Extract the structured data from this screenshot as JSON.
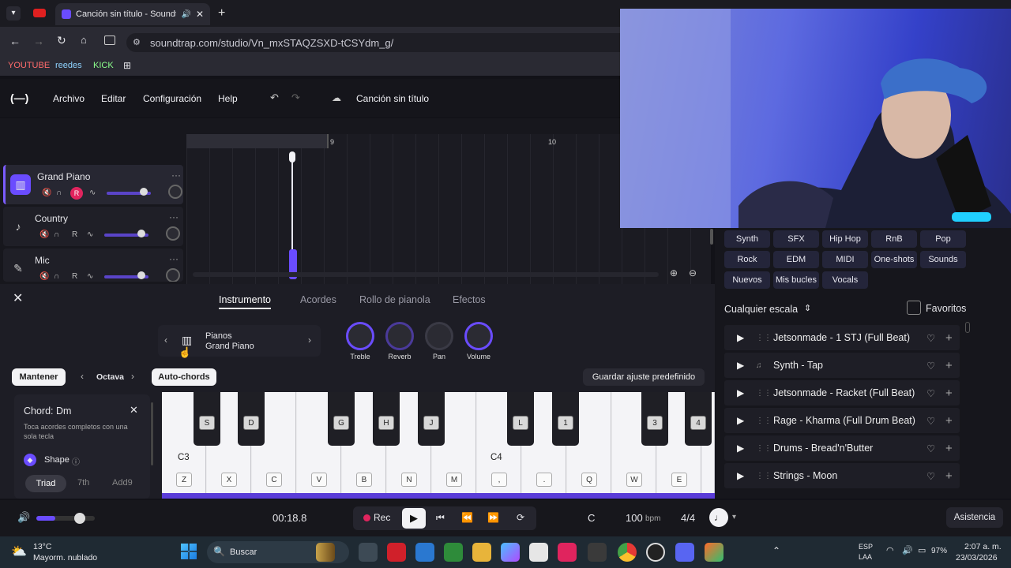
{
  "browser": {
    "tab_title": "Canción sin título - Soundtr",
    "url": "soundtrap.com/studio/Vn_mxSTAQZSXD-tCSYdm_g/",
    "bookmarks": [
      "YOUTUBE",
      "reedes",
      "KICK"
    ]
  },
  "app": {
    "logo": "(—)",
    "menu": [
      "Archivo",
      "Editar",
      "Configuración",
      "Help"
    ],
    "song_title": "Canción sin título"
  },
  "ruler": {
    "marks": [
      "9",
      "10"
    ]
  },
  "tracks": [
    {
      "name": "Grand Piano",
      "icon": "piano-icon",
      "rec": "R"
    },
    {
      "name": "Country",
      "icon": "guitar-icon",
      "rec": "R"
    },
    {
      "name": "Mic",
      "icon": "mic-icon",
      "rec": "R"
    }
  ],
  "instrument_panel": {
    "tabs": [
      "Instrumento",
      "Acordes",
      "Rollo de pianola",
      "Efectos"
    ],
    "active_tab": "Instrumento",
    "category": "Pianos",
    "preset": "Grand Piano",
    "knobs": [
      "Treble",
      "Reverb",
      "Pan",
      "Volume"
    ],
    "hold_label": "Mantener",
    "octave_label": "Octava",
    "autochords_label": "Auto-chords",
    "save_preset": "Guardar ajuste predefinido",
    "chord_title": "Chord: Dm",
    "chord_desc": "Toca acordes completos con una sola tecla",
    "shape_label": "Shape",
    "shape_options": [
      "Triad",
      "7th",
      "Add9"
    ],
    "selected_shape": "Triad"
  },
  "keyboard": {
    "octave_labels": [
      "C3",
      "C4"
    ],
    "white_keys": [
      "Z",
      "X",
      "C",
      "V",
      "B",
      "N",
      "M",
      ",",
      ".",
      "Q",
      "W",
      "E"
    ],
    "black_keys": [
      "S",
      "D",
      "G",
      "H",
      "J",
      "L",
      "1",
      "3",
      "4"
    ]
  },
  "browser_panel": {
    "genres": [
      "Synth",
      "SFX",
      "Hip Hop",
      "RnB",
      "Pop",
      "Rock",
      "EDM",
      "MIDI",
      "One-shots",
      "Sounds",
      "Nuevos",
      "Mis bucles",
      "Vocals"
    ],
    "scale_label": "Cualquier escala",
    "favorites_label": "Favoritos",
    "loops": [
      "Jetsonmade - 1 STJ (Full Beat)",
      "Synth - Tap",
      "Jetsonmade - Racket (Full Beat)",
      "Rage - Kharma (Full Drum Beat)",
      "Drums - Bread'n'Butter",
      "Strings - Moon"
    ]
  },
  "transport": {
    "time": "00:18.8",
    "rec_label": "Rec",
    "key": "C",
    "bpm": "100",
    "bpm_unit": "bpm",
    "meter": "4/4",
    "help": "Asistencia"
  },
  "taskbar": {
    "weather_temp": "13°C",
    "weather_desc": "Mayorm. nublado",
    "search": "Buscar",
    "lang": "ESP",
    "lang2": "LAA",
    "battery": "97%",
    "time": "2:07 a. m.",
    "date": "23/03/2026"
  },
  "colors": {
    "accent": "#7b5cff",
    "rec": "#e0245e"
  }
}
